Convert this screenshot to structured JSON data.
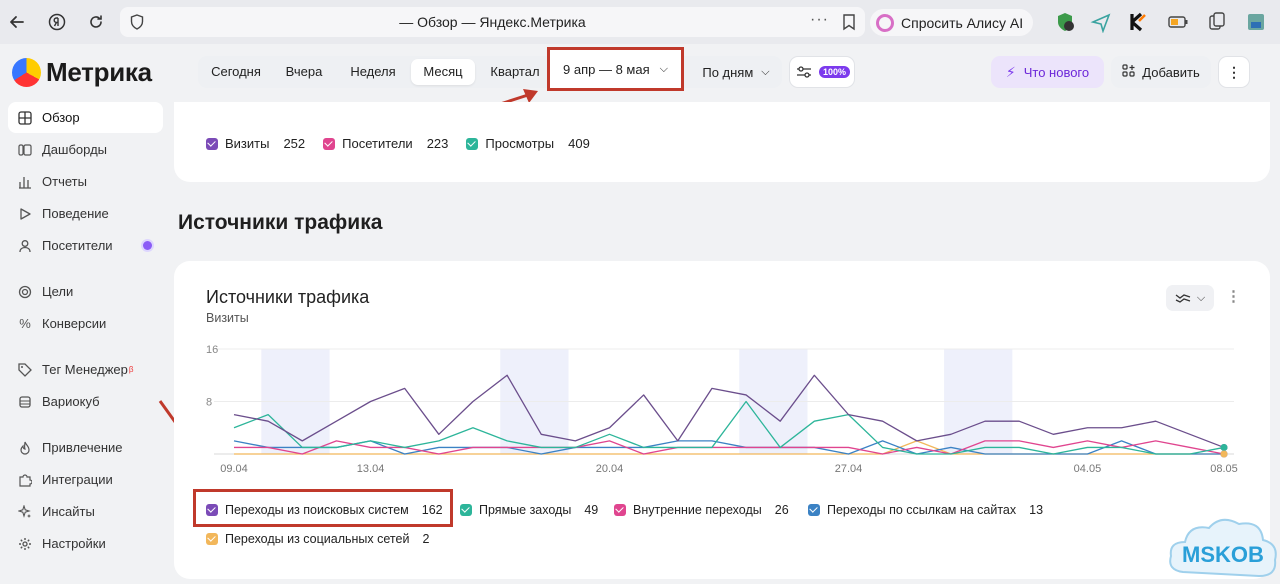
{
  "browser": {
    "title": "— Обзор — Яндекс.Метрика",
    "alice_label": "Спросить Алису AI",
    "more": "···"
  },
  "brand": {
    "name": "Метрика"
  },
  "sidebar": {
    "items": [
      {
        "label": "Обзор",
        "icon": "grid-icon",
        "active": true
      },
      {
        "label": "Дашборды",
        "icon": "dashboard-icon"
      },
      {
        "label": "Отчеты",
        "icon": "bar-chart-icon"
      },
      {
        "label": "Поведение",
        "icon": "play-icon"
      },
      {
        "label": "Посетители",
        "icon": "user-icon",
        "badge": true
      },
      {
        "label": "Цели",
        "icon": "target-icon"
      },
      {
        "label": "Конверсии",
        "icon": "percent-icon"
      },
      {
        "label": "Тег Менеджер",
        "icon": "tag-icon",
        "superscript": "β"
      },
      {
        "label": "Вариокуб",
        "icon": "cube-icon"
      },
      {
        "label": "Привлечение",
        "icon": "fire-icon"
      },
      {
        "label": "Интеграции",
        "icon": "puzzle-icon"
      },
      {
        "label": "Инсайты",
        "icon": "sparkle-icon"
      },
      {
        "label": "Настройки",
        "icon": "gear-icon"
      }
    ]
  },
  "toolbar": {
    "periods": [
      "Сегодня",
      "Вчера",
      "Неделя",
      "Месяц",
      "Квартал"
    ],
    "active_period": "Месяц",
    "date_range": "9 апр — 8 мая",
    "grouping": "По дням",
    "sampling": "100%",
    "whats_new": "Что нового",
    "add": "Добавить"
  },
  "summary": {
    "metrics": [
      {
        "label": "Визиты",
        "value": "252",
        "color": "#7b4bb7"
      },
      {
        "label": "Посетители",
        "value": "223",
        "color": "#e0458f"
      },
      {
        "label": "Просмотры",
        "value": "409",
        "color": "#2db59a"
      }
    ]
  },
  "section_title": "Источники трафика",
  "card": {
    "title": "Источники трафика",
    "subtitle": "Визиты",
    "legend": [
      {
        "label": "Переходы из поисковых систем",
        "value": "162",
        "color": "#7b4bb7"
      },
      {
        "label": "Прямые заходы",
        "value": "49",
        "color": "#2db59a"
      },
      {
        "label": "Внутренние переходы",
        "value": "26",
        "color": "#e0458f"
      },
      {
        "label": "Переходы по ссылкам на сайтах",
        "value": "13",
        "color": "#3b82c4"
      },
      {
        "label": "Переходы из социальных сетей",
        "value": "2",
        "color": "#f2b75b"
      }
    ]
  },
  "chart_data": {
    "type": "line",
    "title": "Источники трафика",
    "ylabel": "Визиты",
    "ylim": [
      0,
      16
    ],
    "yticks": [
      "8",
      "16"
    ],
    "xticks": [
      "09.04",
      "13.04",
      "20.04",
      "27.04",
      "04.05",
      "08.05"
    ],
    "x": [
      "09.04",
      "10.04",
      "11.04",
      "12.04",
      "13.04",
      "14.04",
      "15.04",
      "16.04",
      "17.04",
      "18.04",
      "19.04",
      "20.04",
      "21.04",
      "22.04",
      "23.04",
      "24.04",
      "25.04",
      "26.04",
      "27.04",
      "28.04",
      "29.04",
      "30.04",
      "01.05",
      "02.05",
      "03.05",
      "04.05",
      "05.05",
      "06.05",
      "07.05",
      "08.05"
    ],
    "weekend_bands": [
      [
        0.8,
        2.8
      ],
      [
        7.8,
        9.8
      ],
      [
        14.8,
        16.8
      ],
      [
        20.8,
        22.8
      ]
    ],
    "series": [
      {
        "name": "Переходы из поисковых систем",
        "color": "#6b4e8c",
        "values": [
          6,
          5,
          2,
          5,
          8,
          10,
          3,
          8,
          12,
          3,
          2,
          4,
          9,
          2,
          10,
          9,
          5,
          12,
          6,
          5,
          2,
          3,
          5,
          5,
          3,
          4,
          4,
          5,
          3,
          1
        ]
      },
      {
        "name": "Прямые заходы",
        "color": "#2db59a",
        "values": [
          4,
          6,
          1,
          1,
          2,
          1,
          2,
          4,
          2,
          1,
          1,
          3,
          1,
          1,
          1,
          8,
          1,
          5,
          6,
          1,
          0,
          0,
          1,
          1,
          0,
          1,
          1,
          0,
          0,
          1
        ]
      },
      {
        "name": "Внутренние переходы",
        "color": "#e0458f",
        "values": [
          1,
          1,
          0,
          2,
          1,
          1,
          0,
          1,
          1,
          1,
          1,
          2,
          0,
          1,
          1,
          1,
          1,
          1,
          1,
          0,
          1,
          0,
          2,
          2,
          1,
          2,
          1,
          2,
          1,
          0
        ]
      },
      {
        "name": "Переходы по ссылкам на сайтах",
        "color": "#3b82c4",
        "values": [
          2,
          1,
          1,
          1,
          2,
          0,
          1,
          1,
          1,
          0,
          1,
          1,
          1,
          2,
          2,
          1,
          1,
          1,
          0,
          2,
          0,
          1,
          0,
          0,
          0,
          0,
          2,
          0,
          0,
          0
        ]
      },
      {
        "name": "Переходы из социальных сетей",
        "color": "#f2b75b",
        "values": [
          0,
          0,
          0,
          0,
          0,
          0,
          0,
          0,
          0,
          0,
          0,
          0,
          0,
          0,
          0,
          0,
          0,
          0,
          0,
          0,
          2,
          0,
          0,
          0,
          0,
          0,
          0,
          0,
          0,
          0
        ]
      }
    ],
    "grid": true
  },
  "watermark": "MSKOB"
}
